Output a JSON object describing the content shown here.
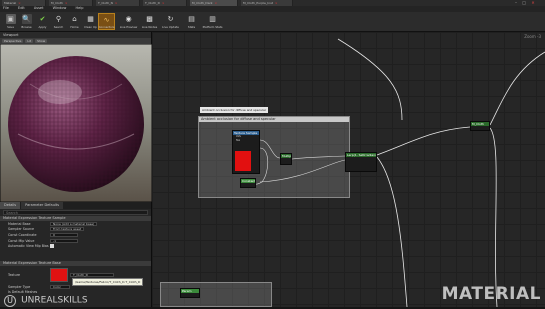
{
  "tabs": [
    {
      "label": "Material",
      "active": false
    },
    {
      "label": "M_Cloth",
      "active": false
    },
    {
      "label": "T_Cloth_N",
      "active": false
    },
    {
      "label": "T_Cloth_D",
      "active": false
    },
    {
      "label": "M_Cloth_Dark",
      "active": true
    },
    {
      "label": "M_Cloth_Purple_Inst",
      "active": false
    }
  ],
  "menu": [
    "File",
    "Edit",
    "Asset",
    "Window",
    "Help"
  ],
  "toolbar": [
    {
      "label": "Save",
      "icon": "save-icon"
    },
    {
      "label": "Browse",
      "icon": "browse-icon"
    },
    {
      "label": "Apply",
      "icon": "apply-icon"
    },
    {
      "label": "Search",
      "icon": "search-icon"
    },
    {
      "label": "Home",
      "icon": "home-icon"
    },
    {
      "label": "Clean Up",
      "icon": "clean-up-icon"
    },
    {
      "label": "Connectors",
      "icon": "connectors-icon"
    },
    {
      "label": "Live Preview",
      "icon": "live-preview-icon"
    },
    {
      "label": "Live Nodes",
      "icon": "live-nodes-icon"
    },
    {
      "label": "Live Update",
      "icon": "live-update-icon"
    },
    {
      "label": "Stats",
      "icon": "stats-icon"
    },
    {
      "label": "Platform Stats",
      "icon": "platform-stats-icon"
    }
  ],
  "viewport": {
    "tab": "Viewport",
    "controls": [
      "Perspective",
      "Lit",
      "Show"
    ]
  },
  "details": {
    "tabs": [
      "Details",
      "Parameter Defaults"
    ],
    "search_placeholder": "Search",
    "section1": "Material Expression Texture Sample",
    "rows1": [
      {
        "key": "Material Base",
        "value": "None (Add a material base)"
      },
      {
        "key": "Sampler Source",
        "value": "From texture asset"
      },
      {
        "key": "Const Coordinate",
        "value": "0"
      },
      {
        "key": "Const Mip Value",
        "value": "-1"
      },
      {
        "key": "Automatic View Mip Bias",
        "value": ""
      }
    ],
    "section2": "Material Expression Texture Base",
    "texture_label": "Texture",
    "texture_value": "T_Cloth_D",
    "tooltip": "/Game/Textures/Fabric/T_Cloth_D.T_Cloth_D",
    "sampler_label": "Sampler Type",
    "sampler_value": "Color",
    "is_default": "Is Default Meshes"
  },
  "graph": {
    "zoom": "Zoom -3",
    "comment_hint": "Ambient occlusion for diffuse and specular",
    "comment_title": "Ambient occlusion for diffuse and specular",
    "nodes": {
      "texture": {
        "title": "Texture Sample",
        "pins": [
          "UVs",
          "Tex",
          "Apply View MipBias"
        ],
        "outs": [
          "RGB",
          "R",
          "G",
          "B",
          "A",
          "RGBA"
        ]
      },
      "mult": {
        "title": "Multiply"
      },
      "power": {
        "title": "Power"
      },
      "lerp": {
        "title": "Lerp(1, SetIrradianceAO)"
      },
      "constant": {
        "title": "Constant"
      },
      "result": {
        "title": "M_Cloth"
      },
      "bottom": {
        "title": "Param"
      }
    }
  },
  "watermark_left": "UNREALSKILLS",
  "watermark_right": "MATERIAL"
}
